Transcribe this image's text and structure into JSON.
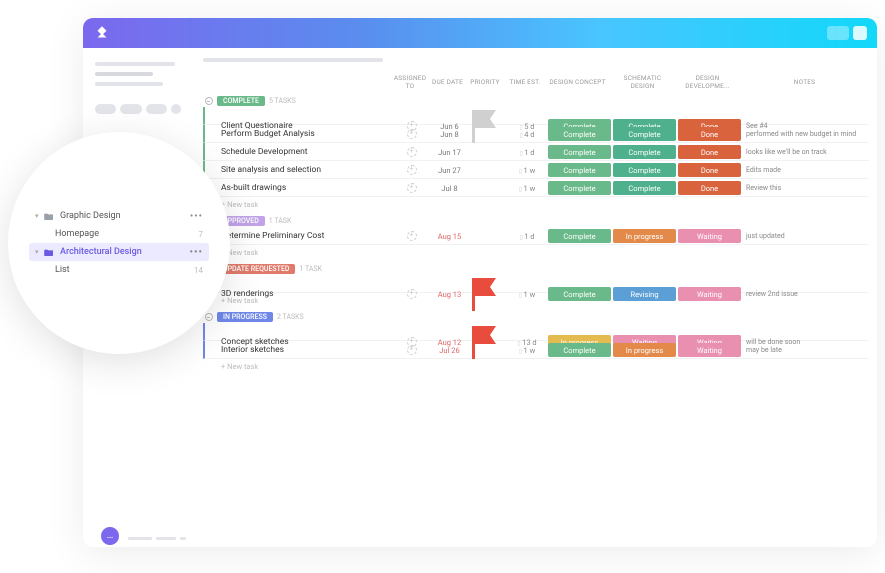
{
  "columns": {
    "assigned_to": "ASSIGNED TO",
    "due_date": "DUE DATE",
    "priority": "PRIORITY",
    "time_est": "TIME EST.",
    "design_concept": "DESIGN CONCEPT",
    "schematic_design": "SCHEMATIC DESIGN",
    "design_development": "DESIGN DEVELOPME...",
    "notes": "NOTES"
  },
  "sidebar": {
    "items": [
      {
        "label": "Graphic Design",
        "type": "folder",
        "count": null,
        "has_more": true
      },
      {
        "label": "Homepage",
        "type": "list",
        "count": "7"
      },
      {
        "label": "Architectural Design",
        "type": "folder",
        "selected": true,
        "has_more": true
      },
      {
        "label": "List",
        "type": "list",
        "count": "14"
      }
    ]
  },
  "groups": [
    {
      "key": "complete",
      "label": "COMPLETE",
      "color": "#6ab98a",
      "count_text": "5 TASKS",
      "tasks": [
        {
          "name": "Client Questionaire",
          "due": "Jun 6",
          "priority": "grey",
          "est": "5 d",
          "c1": {
            "text": "Complete",
            "cls": "green"
          },
          "c2": {
            "text": "Complete",
            "cls": "teal"
          },
          "c3": {
            "text": "Done",
            "cls": "orange"
          },
          "notes": "See #4"
        },
        {
          "name": "Perform Budget Analysis",
          "due": "Jun 8",
          "priority": null,
          "est": "4 d",
          "c1": {
            "text": "Complete",
            "cls": "green"
          },
          "c2": {
            "text": "Complete",
            "cls": "teal"
          },
          "c3": {
            "text": "Done",
            "cls": "orange"
          },
          "notes": "performed with new budget in mind"
        },
        {
          "name": "Schedule Development",
          "due": "Jun 17",
          "priority": null,
          "est": "1 d",
          "c1": {
            "text": "Complete",
            "cls": "green"
          },
          "c2": {
            "text": "Complete",
            "cls": "teal"
          },
          "c3": {
            "text": "Done",
            "cls": "orange"
          },
          "notes": "looks like we'll be on track"
        },
        {
          "name": "Site analysis and selection",
          "due": "Jun 27",
          "priority": null,
          "est": "1 w",
          "c1": {
            "text": "Complete",
            "cls": "green"
          },
          "c2": {
            "text": "Complete",
            "cls": "teal"
          },
          "c3": {
            "text": "Done",
            "cls": "orange"
          },
          "notes": "Edits made"
        },
        {
          "name": "As-built drawings",
          "due": "Jul 8",
          "priority": null,
          "est": "1 w",
          "c1": {
            "text": "Complete",
            "cls": "green"
          },
          "c2": {
            "text": "Complete",
            "cls": "teal"
          },
          "c3": {
            "text": "Done",
            "cls": "orange"
          },
          "notes": "Review this"
        }
      ]
    },
    {
      "key": "approved",
      "label": "APPROVED",
      "color": "#c1a3e8",
      "count_text": "1 TASK",
      "tasks": [
        {
          "name": "Determine Preliminary Cost",
          "due": "Aug 15",
          "due_red": true,
          "priority": null,
          "est": "1 d",
          "c1": {
            "text": "Complete",
            "cls": "green"
          },
          "c2": {
            "text": "In progress",
            "cls": "orange2"
          },
          "c3": {
            "text": "Waiting",
            "cls": "pink"
          },
          "notes": "just updated"
        }
      ]
    },
    {
      "key": "update",
      "label": "UPDATE REQUESTED",
      "color": "#e07a6a",
      "count_text": "1 TASK",
      "tasks": [
        {
          "name": "3D renderings",
          "due": "Aug 13",
          "due_red": true,
          "priority": "red",
          "est": "1 w",
          "c1": {
            "text": "Complete",
            "cls": "green"
          },
          "c2": {
            "text": "Revising",
            "cls": "blue"
          },
          "c3": {
            "text": "Waiting",
            "cls": "pink"
          },
          "notes": "review 2nd issue"
        }
      ]
    },
    {
      "key": "progress",
      "label": "IN PROGRESS",
      "color": "#6f88e8",
      "count_text": "2 TASKS",
      "tasks": [
        {
          "name": "Concept sketches",
          "due": "Aug 12",
          "due_red": true,
          "priority": "red",
          "est": "13 d",
          "c1": {
            "text": "In progress",
            "cls": "yellow"
          },
          "c2": {
            "text": "Waiting",
            "cls": "pink"
          },
          "c3": {
            "text": "Waiting",
            "cls": "pink"
          },
          "notes": "will be done soon"
        },
        {
          "name": "Interior sketches",
          "due": "Jul 26",
          "due_red": true,
          "priority": null,
          "est": "1 w",
          "c1": {
            "text": "Complete",
            "cls": "green"
          },
          "c2": {
            "text": "In progress",
            "cls": "orange2"
          },
          "c3": {
            "text": "Waiting",
            "cls": "pink"
          },
          "notes": "may be late"
        }
      ]
    }
  ],
  "new_task_label": "+ New task"
}
